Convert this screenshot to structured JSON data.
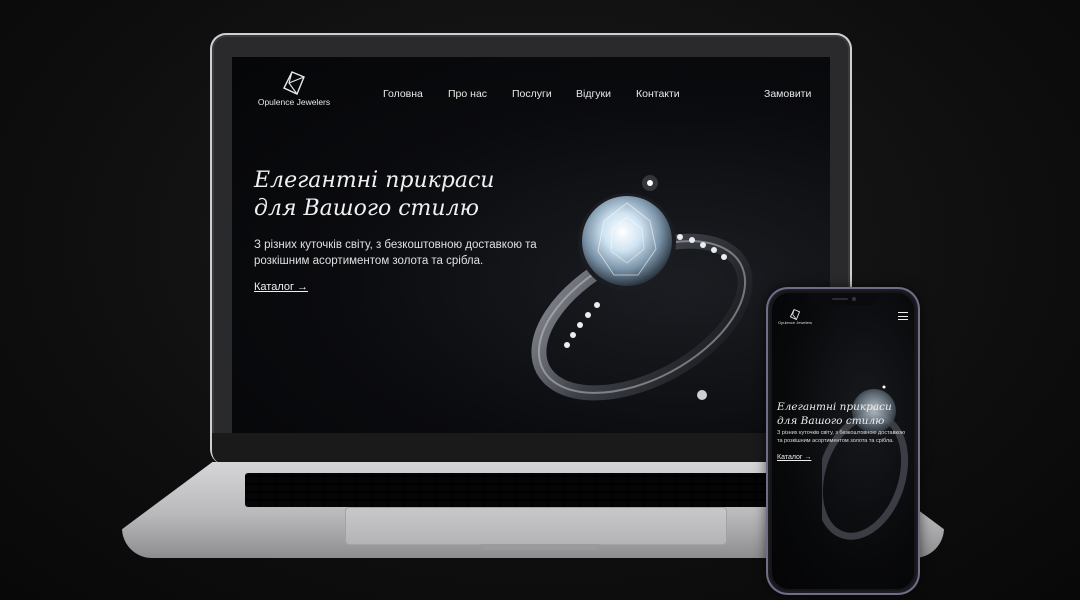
{
  "brand": {
    "name": "Opulence Jewelers",
    "logo_icon": "diamond-outline-icon"
  },
  "nav": {
    "items": [
      {
        "label": "Головна"
      },
      {
        "label": "Про нас"
      },
      {
        "label": "Послуги"
      },
      {
        "label": "Відгуки"
      },
      {
        "label": "Контакти"
      }
    ],
    "cta_label": "Замовити"
  },
  "hero": {
    "title_line1": "Елегантні прикраси",
    "title_line2": "для Вашого стилю",
    "description": "З різних куточків світу, з безкоштовною доставкою та розкішним асортиментом золота та срібла.",
    "link_label": "Каталог →",
    "image": "diamond-ring-photo"
  },
  "mobile": {
    "menu_icon": "hamburger-menu-icon",
    "title_line1": "Елегантні прикраси",
    "title_line2": "для Вашого стилю",
    "description": "З різних куточків світу, з безкоштовною доставкою та розкішним асортиментом золота та срібла.",
    "link_label": "Каталог →"
  },
  "colors": {
    "background": "#0d0d0d",
    "screen": "#0a0b0e",
    "text": "#f0f0f0"
  }
}
